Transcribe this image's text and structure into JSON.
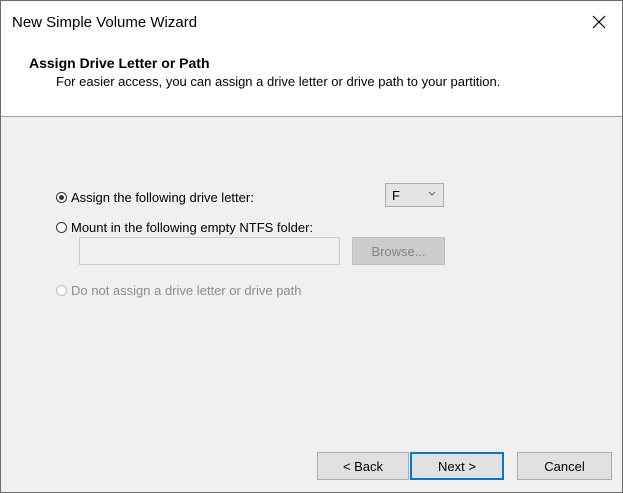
{
  "window": {
    "title": "New Simple Volume Wizard",
    "close_icon": "close-icon"
  },
  "header": {
    "title": "Assign Drive Letter or Path",
    "subtitle": "For easier access, you can assign a drive letter or drive path to your partition."
  },
  "options": {
    "assign_letter_label": "Assign the following drive letter:",
    "assign_letter_checked": true,
    "mount_folder_label": "Mount in the following empty NTFS folder:",
    "no_assign_label": "Do not assign a drive letter or drive path",
    "drive_letter_value": "F",
    "folder_path_value": "",
    "browse_label": "Browse..."
  },
  "buttons": {
    "back_label": "< Back",
    "next_label": "Next >",
    "cancel_label": "Cancel"
  },
  "colors": {
    "accent": "#0078d7",
    "disabled_text": "#8c8c8c"
  }
}
